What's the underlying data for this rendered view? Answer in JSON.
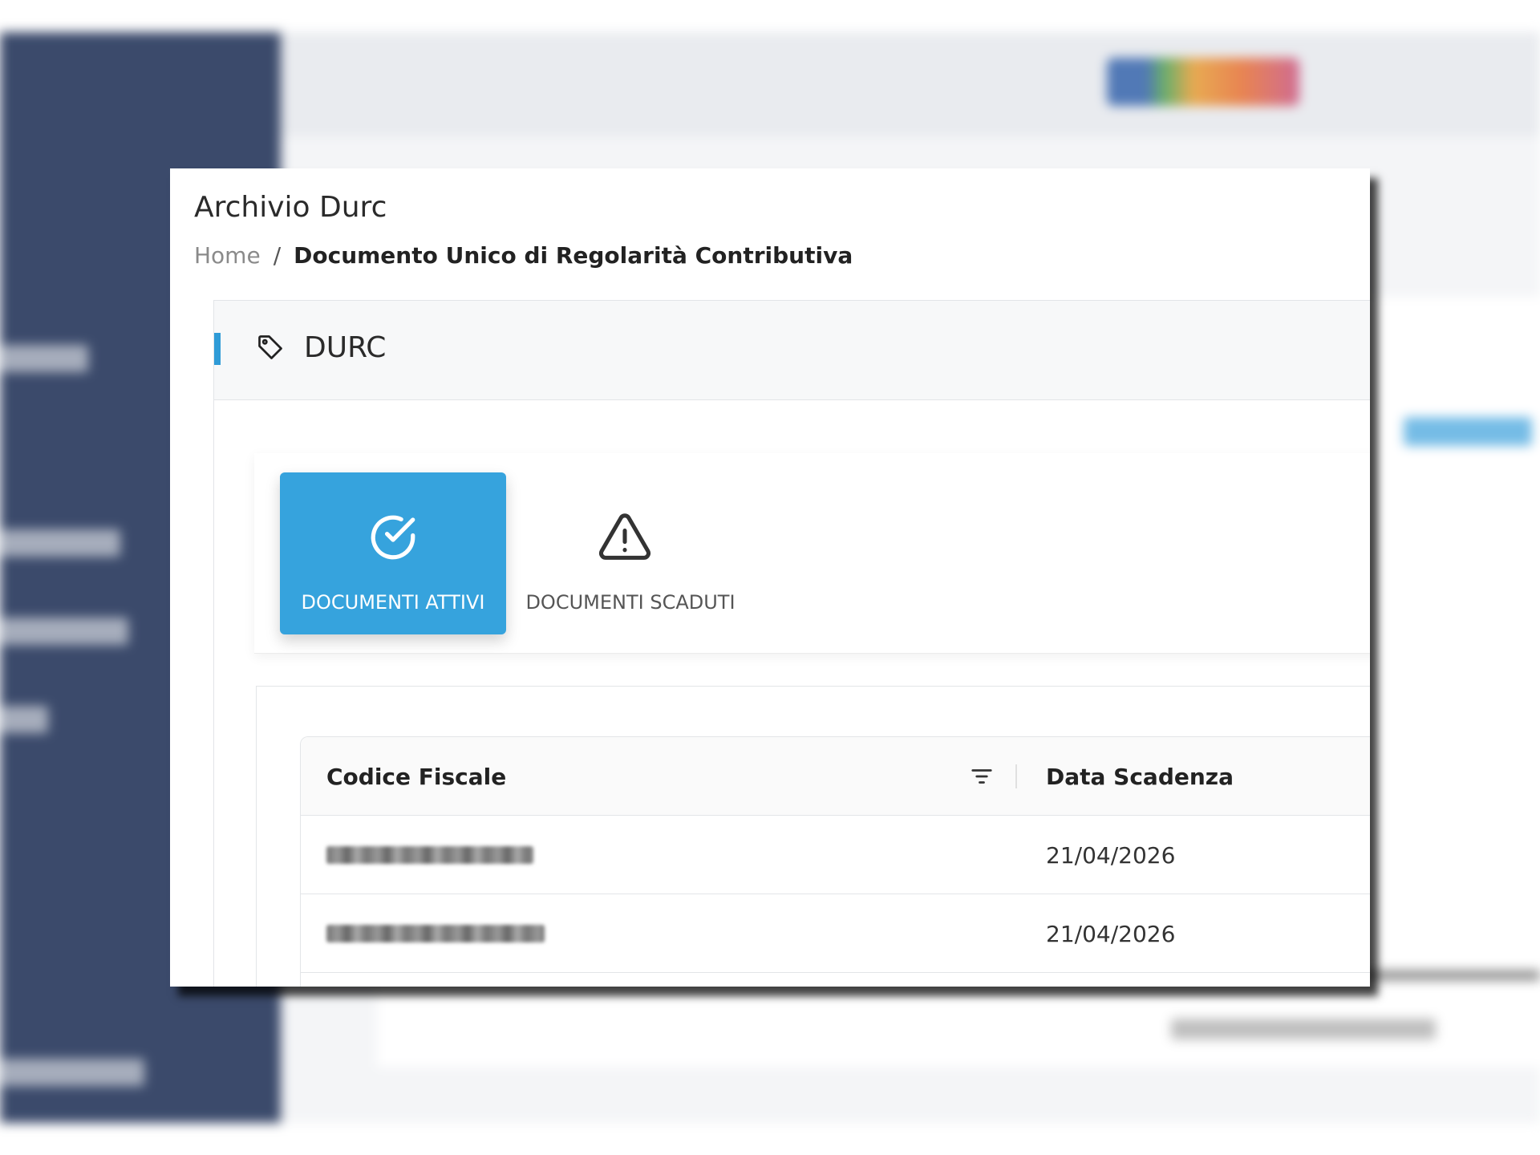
{
  "page": {
    "title": "Archivio Durc"
  },
  "breadcrumb": {
    "home": "Home",
    "separator": "/",
    "current": "Documento Unico di Regolarità Contributiva"
  },
  "card": {
    "title": "DURC",
    "icon": "tag-icon",
    "accent_color": "#2f9bd7"
  },
  "tabs": [
    {
      "label": "DOCUMENTI ATTIVI",
      "icon": "check-circle-icon",
      "active": true,
      "color": "#36a3dd"
    },
    {
      "label": "DOCUMENTI SCADUTI",
      "icon": "warning-triangle-icon",
      "active": false
    }
  ],
  "table": {
    "columns": [
      "Codice Fiscale",
      "Data Scadenza"
    ],
    "filter_icon": "filter-icon",
    "rows": [
      {
        "codice_fiscale": "[redacted]",
        "data_scadenza": "21/04/2026"
      },
      {
        "codice_fiscale": "[redacted]",
        "data_scadenza": "21/04/2026"
      }
    ]
  }
}
